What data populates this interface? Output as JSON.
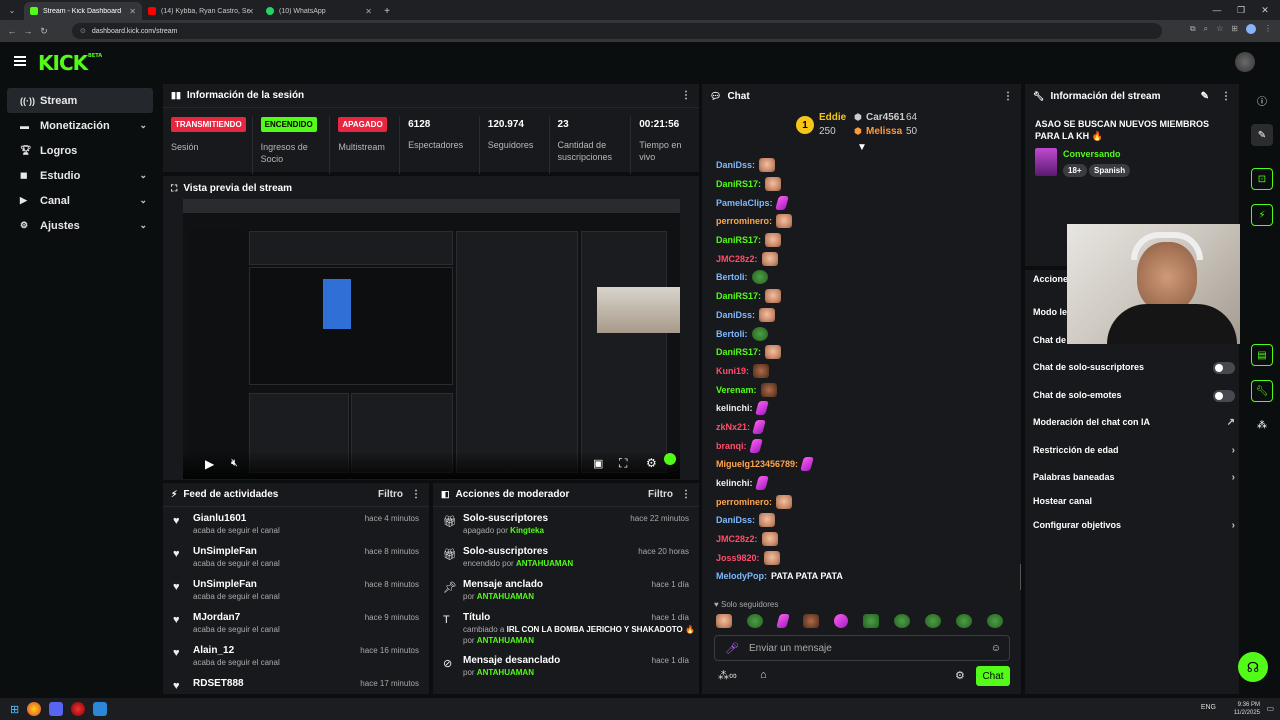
{
  "browser": {
    "tabs": [
      {
        "title": "Stream - Kick Dashboard",
        "color": "#53fc18"
      },
      {
        "title": "(14) Kybba, Ryan Castro, Sean Pa",
        "color": "#ff0000"
      },
      {
        "title": "(10) WhatsApp",
        "color": "#25d366"
      }
    ],
    "url": "dashboard.kick.com/stream"
  },
  "brand": {
    "logo": "KICK",
    "beta": "BETA",
    "accent": "#53fc18"
  },
  "sidebar": {
    "items": [
      {
        "label": "Stream",
        "icon": "stream-icon",
        "active": true
      },
      {
        "label": "Monetización",
        "icon": "money-icon",
        "chevron": true
      },
      {
        "label": "Logros",
        "icon": "trophy-icon"
      },
      {
        "label": "Estudio",
        "icon": "studio-icon",
        "chevron": true
      },
      {
        "label": "Canal",
        "icon": "channel-icon",
        "chevron": true
      },
      {
        "label": "Ajustes",
        "icon": "gear-icon",
        "chevron": true
      }
    ]
  },
  "session": {
    "title": "Información de la sesión",
    "stats": [
      {
        "badge": "TRANSMITIENDO",
        "badge_color": "red",
        "label": "Sesión"
      },
      {
        "badge": "ENCENDIDO",
        "badge_color": "green",
        "label": "Ingresos de Socio"
      },
      {
        "badge": "APAGADO",
        "badge_color": "red",
        "label": "Multistream"
      },
      {
        "value": "6128",
        "label": "Espectadores"
      },
      {
        "value": "120.974",
        "label": "Seguidores"
      },
      {
        "value": "23",
        "label": "Cantidad de suscripciones"
      },
      {
        "value": "00:21:56",
        "label": "Tiempo en vivo"
      }
    ]
  },
  "preview": {
    "title": "Vista previa del stream"
  },
  "activity": {
    "title": "Feed de actividades",
    "filter": "Filtro",
    "items": [
      {
        "name": "Gianlu1601",
        "sub": "acaba de seguir el canal",
        "time": "hace 4 minutos"
      },
      {
        "name": "UnSimpleFan",
        "sub": "acaba de seguir el canal",
        "time": "hace 8 minutos"
      },
      {
        "name": "UnSimpleFan",
        "sub": "acaba de seguir el canal",
        "time": "hace 8 minutos"
      },
      {
        "name": "MJordan7",
        "sub": "acaba de seguir el canal",
        "time": "hace 9 minutos"
      },
      {
        "name": "Alain_12",
        "sub": "acaba de seguir el canal",
        "time": "hace 16 minutos"
      },
      {
        "name": "RDSET888",
        "sub": "",
        "time": "hace 17 minutos"
      }
    ]
  },
  "moderator": {
    "title": "Acciones de moderador",
    "filter": "Filtro",
    "items": [
      {
        "name": "Solo-suscriptores",
        "pre": "apagado por",
        "by": "Kingteka",
        "time": "hace 22 minutos",
        "icon": "gift-icon"
      },
      {
        "name": "Solo-suscriptores",
        "pre": "encendido por",
        "by": "ANTAHUAMAN",
        "time": "hace 20 horas",
        "icon": "gift-icon"
      },
      {
        "name": "Mensaje anclado",
        "pre": "por",
        "by": "ANTAHUAMAN",
        "time": "hace 1 día",
        "icon": "pin-icon"
      },
      {
        "name": "Título",
        "pre": "cambiado a",
        "extra": "IRL CON LA BOMBA JERICHO Y SHAKADOTO 🔥",
        "pre2": "por",
        "by": "ANTAHUAMAN",
        "time": "hace 1 día",
        "icon": "text-icon"
      },
      {
        "name": "Mensaje desanclado",
        "pre": "por",
        "by": "ANTAHUAMAN",
        "time": "hace 1 día",
        "icon": "unpin-icon"
      }
    ]
  },
  "chat": {
    "title": "Chat",
    "leaderboard": [
      {
        "name": "Eddie",
        "score": "250",
        "rank": "1"
      },
      {
        "name": "Car4561",
        "score": "64"
      },
      {
        "name": "Melissa",
        "score": "50"
      }
    ],
    "messages": [
      {
        "user": "DaniDss:",
        "color": "#7db9ff",
        "emote": "face"
      },
      {
        "user": "DaniRS17:",
        "color": "#53fc18",
        "emote": "face"
      },
      {
        "user": "PamelaClips:",
        "color": "#7db9ff",
        "emote": "pink"
      },
      {
        "user": "perrominero:",
        "color": "#ffa64d",
        "emote": "face"
      },
      {
        "user": "DaniRS17:",
        "color": "#53fc18",
        "emote": "face"
      },
      {
        "user": "JMC28z2:",
        "color": "#ff4d6d",
        "emote": "face"
      },
      {
        "user": "Bertoli:",
        "color": "#7db9ff",
        "emote": "frog"
      },
      {
        "user": "DaniRS17:",
        "color": "#53fc18",
        "emote": "face"
      },
      {
        "user": "DaniDss:",
        "color": "#7db9ff",
        "emote": "face"
      },
      {
        "user": "Bertoli:",
        "color": "#7db9ff",
        "emote": "frog"
      },
      {
        "user": "DaniRS17:",
        "color": "#53fc18",
        "emote": "face"
      },
      {
        "user": "Kuni19:",
        "color": "#ff4d6d",
        "emote": "dark"
      },
      {
        "user": "Verenam:",
        "color": "#53fc18",
        "emote": "dark"
      },
      {
        "user": "kelinchi:",
        "color": "#f0f0f0",
        "emote": "pink"
      },
      {
        "user": "zkNx21:",
        "color": "#ff4d6d",
        "emote": "pink"
      },
      {
        "user": "branqi:",
        "color": "#ff4d6d",
        "emote": "pink"
      },
      {
        "user": "Miguelg123456789:",
        "color": "#ffa64d",
        "emote": "pink"
      },
      {
        "user": "kelinchi:",
        "color": "#f0f0f0",
        "emote": "pink"
      },
      {
        "user": "perrominero:",
        "color": "#ffa64d",
        "emote": "face"
      },
      {
        "user": "DaniDss:",
        "color": "#7db9ff",
        "emote": "face"
      },
      {
        "user": "JMC28z2:",
        "color": "#ff4d6d",
        "emote": "face"
      },
      {
        "user": "Joss9820:",
        "color": "#ff4d6d",
        "emote": "face"
      },
      {
        "user": "MelodyPop:",
        "color": "#7db9ff",
        "text": "PATA PATA PATA"
      }
    ],
    "followers_only": "Solo seguidores",
    "input_placeholder": "Enviar un mensaje",
    "send_label": "Chat"
  },
  "stream_info": {
    "title": "Información del stream",
    "stream_title": "ASAO SE BUSCAN NUEVOS MIEMBROS PARA LA KH 🔥",
    "category": "Conversando",
    "tags": [
      "18+",
      "Spanish"
    ]
  },
  "actions": {
    "title": "Acciones",
    "rows": [
      {
        "label": "Modo le",
        "control": "none"
      },
      {
        "label": "Chat de",
        "control": "none"
      },
      {
        "label": "Chat de solo-suscriptores",
        "control": "toggle"
      },
      {
        "label": "Chat de solo-emotes",
        "control": "toggle"
      },
      {
        "label": "Moderación del chat con IA",
        "control": "link"
      },
      {
        "label": "Restricción de edad",
        "control": "arrow"
      },
      {
        "label": "Palabras baneadas",
        "control": "arrow"
      },
      {
        "label": "Hostear canal",
        "control": "none"
      },
      {
        "label": "Configurar objetivos",
        "control": "arrow"
      }
    ]
  },
  "taskbar": {
    "lang": "ENG",
    "time": "9:36 PM",
    "date": "11/2/2025"
  }
}
